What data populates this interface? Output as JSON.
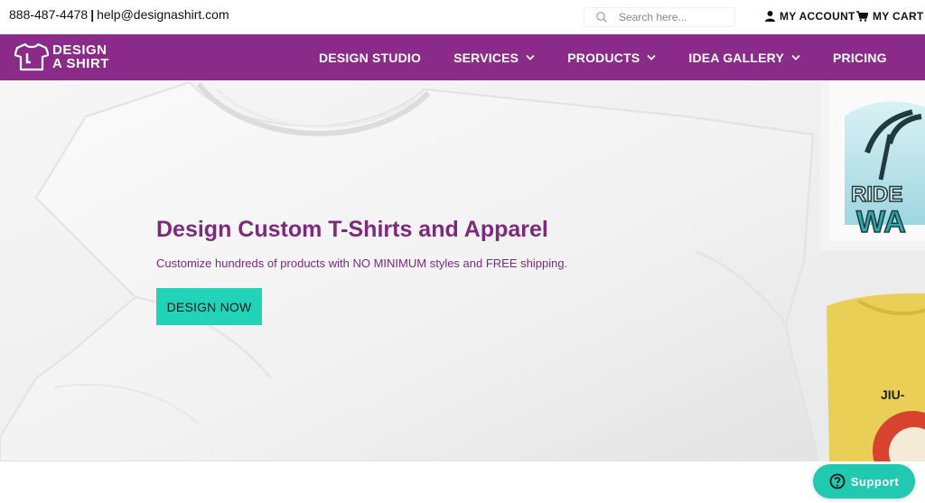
{
  "topbar": {
    "phone": "888-487-4478",
    "separator": "|",
    "email": "help@designashirt.com",
    "search_placeholder": "Search here...",
    "account_label": "MY ACCOUNT",
    "cart_label": "MY CART"
  },
  "nav": {
    "logo_line1": "DESIGN",
    "logo_line2": "A SHIRT",
    "items": [
      {
        "label": "DESIGN STUDIO",
        "dropdown": false
      },
      {
        "label": "SERVICES",
        "dropdown": true
      },
      {
        "label": "PRODUCTS",
        "dropdown": true
      },
      {
        "label": "IDEA GALLERY",
        "dropdown": true
      },
      {
        "label": "PRICING",
        "dropdown": false
      }
    ]
  },
  "hero": {
    "title": "Design Custom T-Shirts and Apparel",
    "subtitle": "Customize hundreds of products with NO MINIMUM styles and FREE shipping.",
    "cta_label": "DESIGN NOW",
    "shirt_text_1": "RIDE",
    "shirt_text_2": "WA",
    "shirt_text_3": "JIU-"
  },
  "support": {
    "label": "Support"
  },
  "colors": {
    "brand_purple": "#8a2b8a",
    "heading_purple": "#7d2a7e",
    "accent_teal": "#21d3b9",
    "support_teal": "#21c9b0"
  },
  "icons": [
    "search-icon",
    "user-icon",
    "cart-icon",
    "shirt-logo-icon",
    "chevron-down-icon",
    "question-circle-icon"
  ]
}
